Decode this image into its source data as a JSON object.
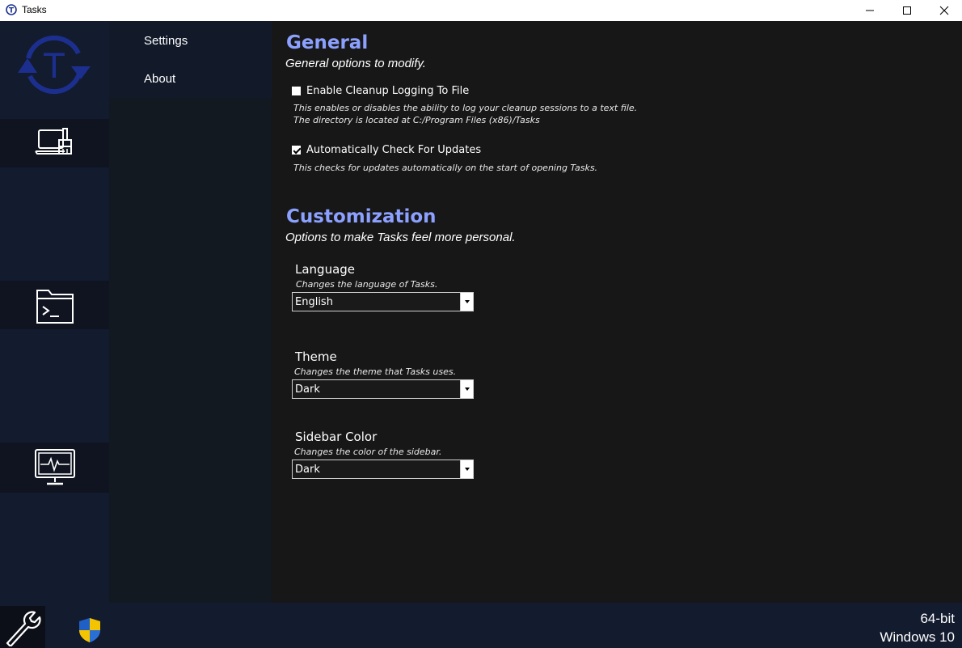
{
  "window": {
    "title": "Tasks",
    "controls": [
      "minimize",
      "maximize",
      "close"
    ]
  },
  "rail": {
    "logo_letter": "T",
    "buttons": [
      {
        "icon": "laptop-cleanup-icon"
      },
      {
        "icon": "terminal-folder-icon"
      },
      {
        "icon": "monitor-activity-icon"
      }
    ]
  },
  "subnav": {
    "items": [
      {
        "label": "Settings"
      },
      {
        "label": "About"
      }
    ]
  },
  "general": {
    "title": "General",
    "subtitle": "General options to modify.",
    "cleanup_logging": {
      "label": "Enable Cleanup Logging To File",
      "checked": false,
      "desc_line1": "This enables or disables the ability to log your cleanup sessions to a text file.",
      "desc_line2": "The directory is located at C:/Program Files (x86)/Tasks"
    },
    "auto_update": {
      "label": "Automatically Check For Updates",
      "checked": true,
      "desc": "This checks for updates automatically on the start of opening Tasks."
    }
  },
  "customization": {
    "title": "Customization",
    "subtitle": "Options to make Tasks feel more personal.",
    "language": {
      "label": "Language",
      "desc": "Changes the language of Tasks.",
      "value": "English"
    },
    "theme": {
      "label": "Theme",
      "desc": "Changes the theme that Tasks uses.",
      "value": "Dark"
    },
    "sidebar_color": {
      "label": "Sidebar Color",
      "desc": "Changes the color of the sidebar.",
      "value": "Dark"
    }
  },
  "footer": {
    "arch": "64-bit",
    "os": "Windows 10",
    "icons": [
      "wrench-icon",
      "windows-shield-icon"
    ]
  },
  "colors": {
    "accent": "#8ca0ff",
    "logo": "#1c2f8f",
    "rail_bg": "#131b2e",
    "main_bg": "#171717"
  }
}
